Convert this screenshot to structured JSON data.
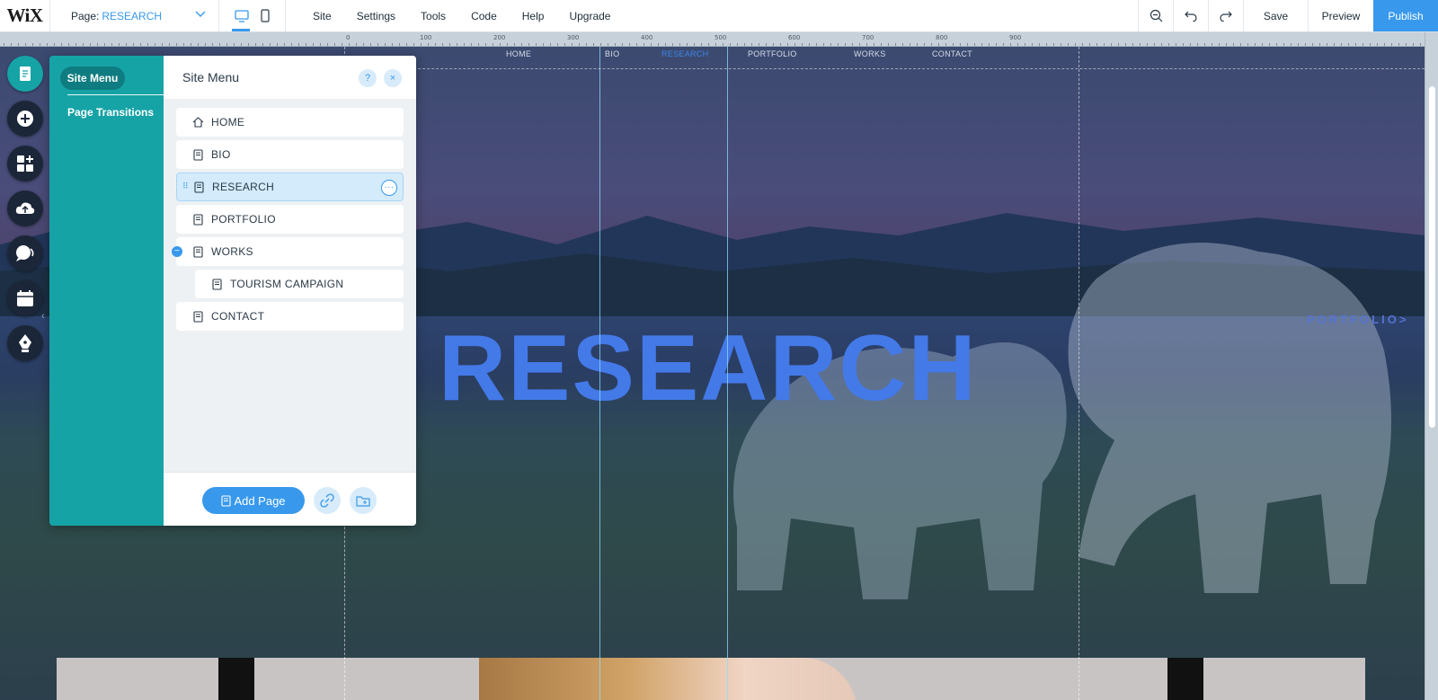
{
  "topbar": {
    "logo": "WiX",
    "page_label": "Page:",
    "page_value": "RESEARCH",
    "menu": [
      "Site",
      "Settings",
      "Tools",
      "Code",
      "Help",
      "Upgrade"
    ],
    "save": "Save",
    "preview": "Preview",
    "publish": "Publish"
  },
  "ruler": {
    "labels": [
      "0",
      "100",
      "200",
      "300",
      "400",
      "500",
      "600",
      "700",
      "800",
      "900"
    ]
  },
  "site": {
    "nav": [
      "HOME",
      "BIO",
      "RESEARCH",
      "PORTFOLIO",
      "WORKS",
      "CONTACT"
    ],
    "active_nav": "RESEARCH",
    "hero_title": "RESEARCH",
    "portfolio_link": "PORTFOLIO>"
  },
  "panel": {
    "side_tabs": [
      "Site Menu",
      "Page Transitions"
    ],
    "title": "Site Menu",
    "help": "?",
    "close": "×",
    "pages": [
      {
        "label": "HOME",
        "icon": "home-icon"
      },
      {
        "label": "BIO",
        "icon": "page-icon"
      },
      {
        "label": "RESEARCH",
        "icon": "page-icon",
        "selected": true
      },
      {
        "label": "PORTFOLIO",
        "icon": "page-icon"
      },
      {
        "label": "WORKS",
        "icon": "page-icon"
      },
      {
        "label": "TOURISM CAMPAIGN",
        "icon": "page-icon",
        "sub": true
      },
      {
        "label": "CONTACT",
        "icon": "page-icon"
      }
    ],
    "add_page": "Add Page",
    "more": "···",
    "drag": "⠿",
    "collapse": "−"
  },
  "colors": {
    "accent": "#3899ec",
    "panel_side": "#16a3a6",
    "hero": "#4479e8"
  }
}
